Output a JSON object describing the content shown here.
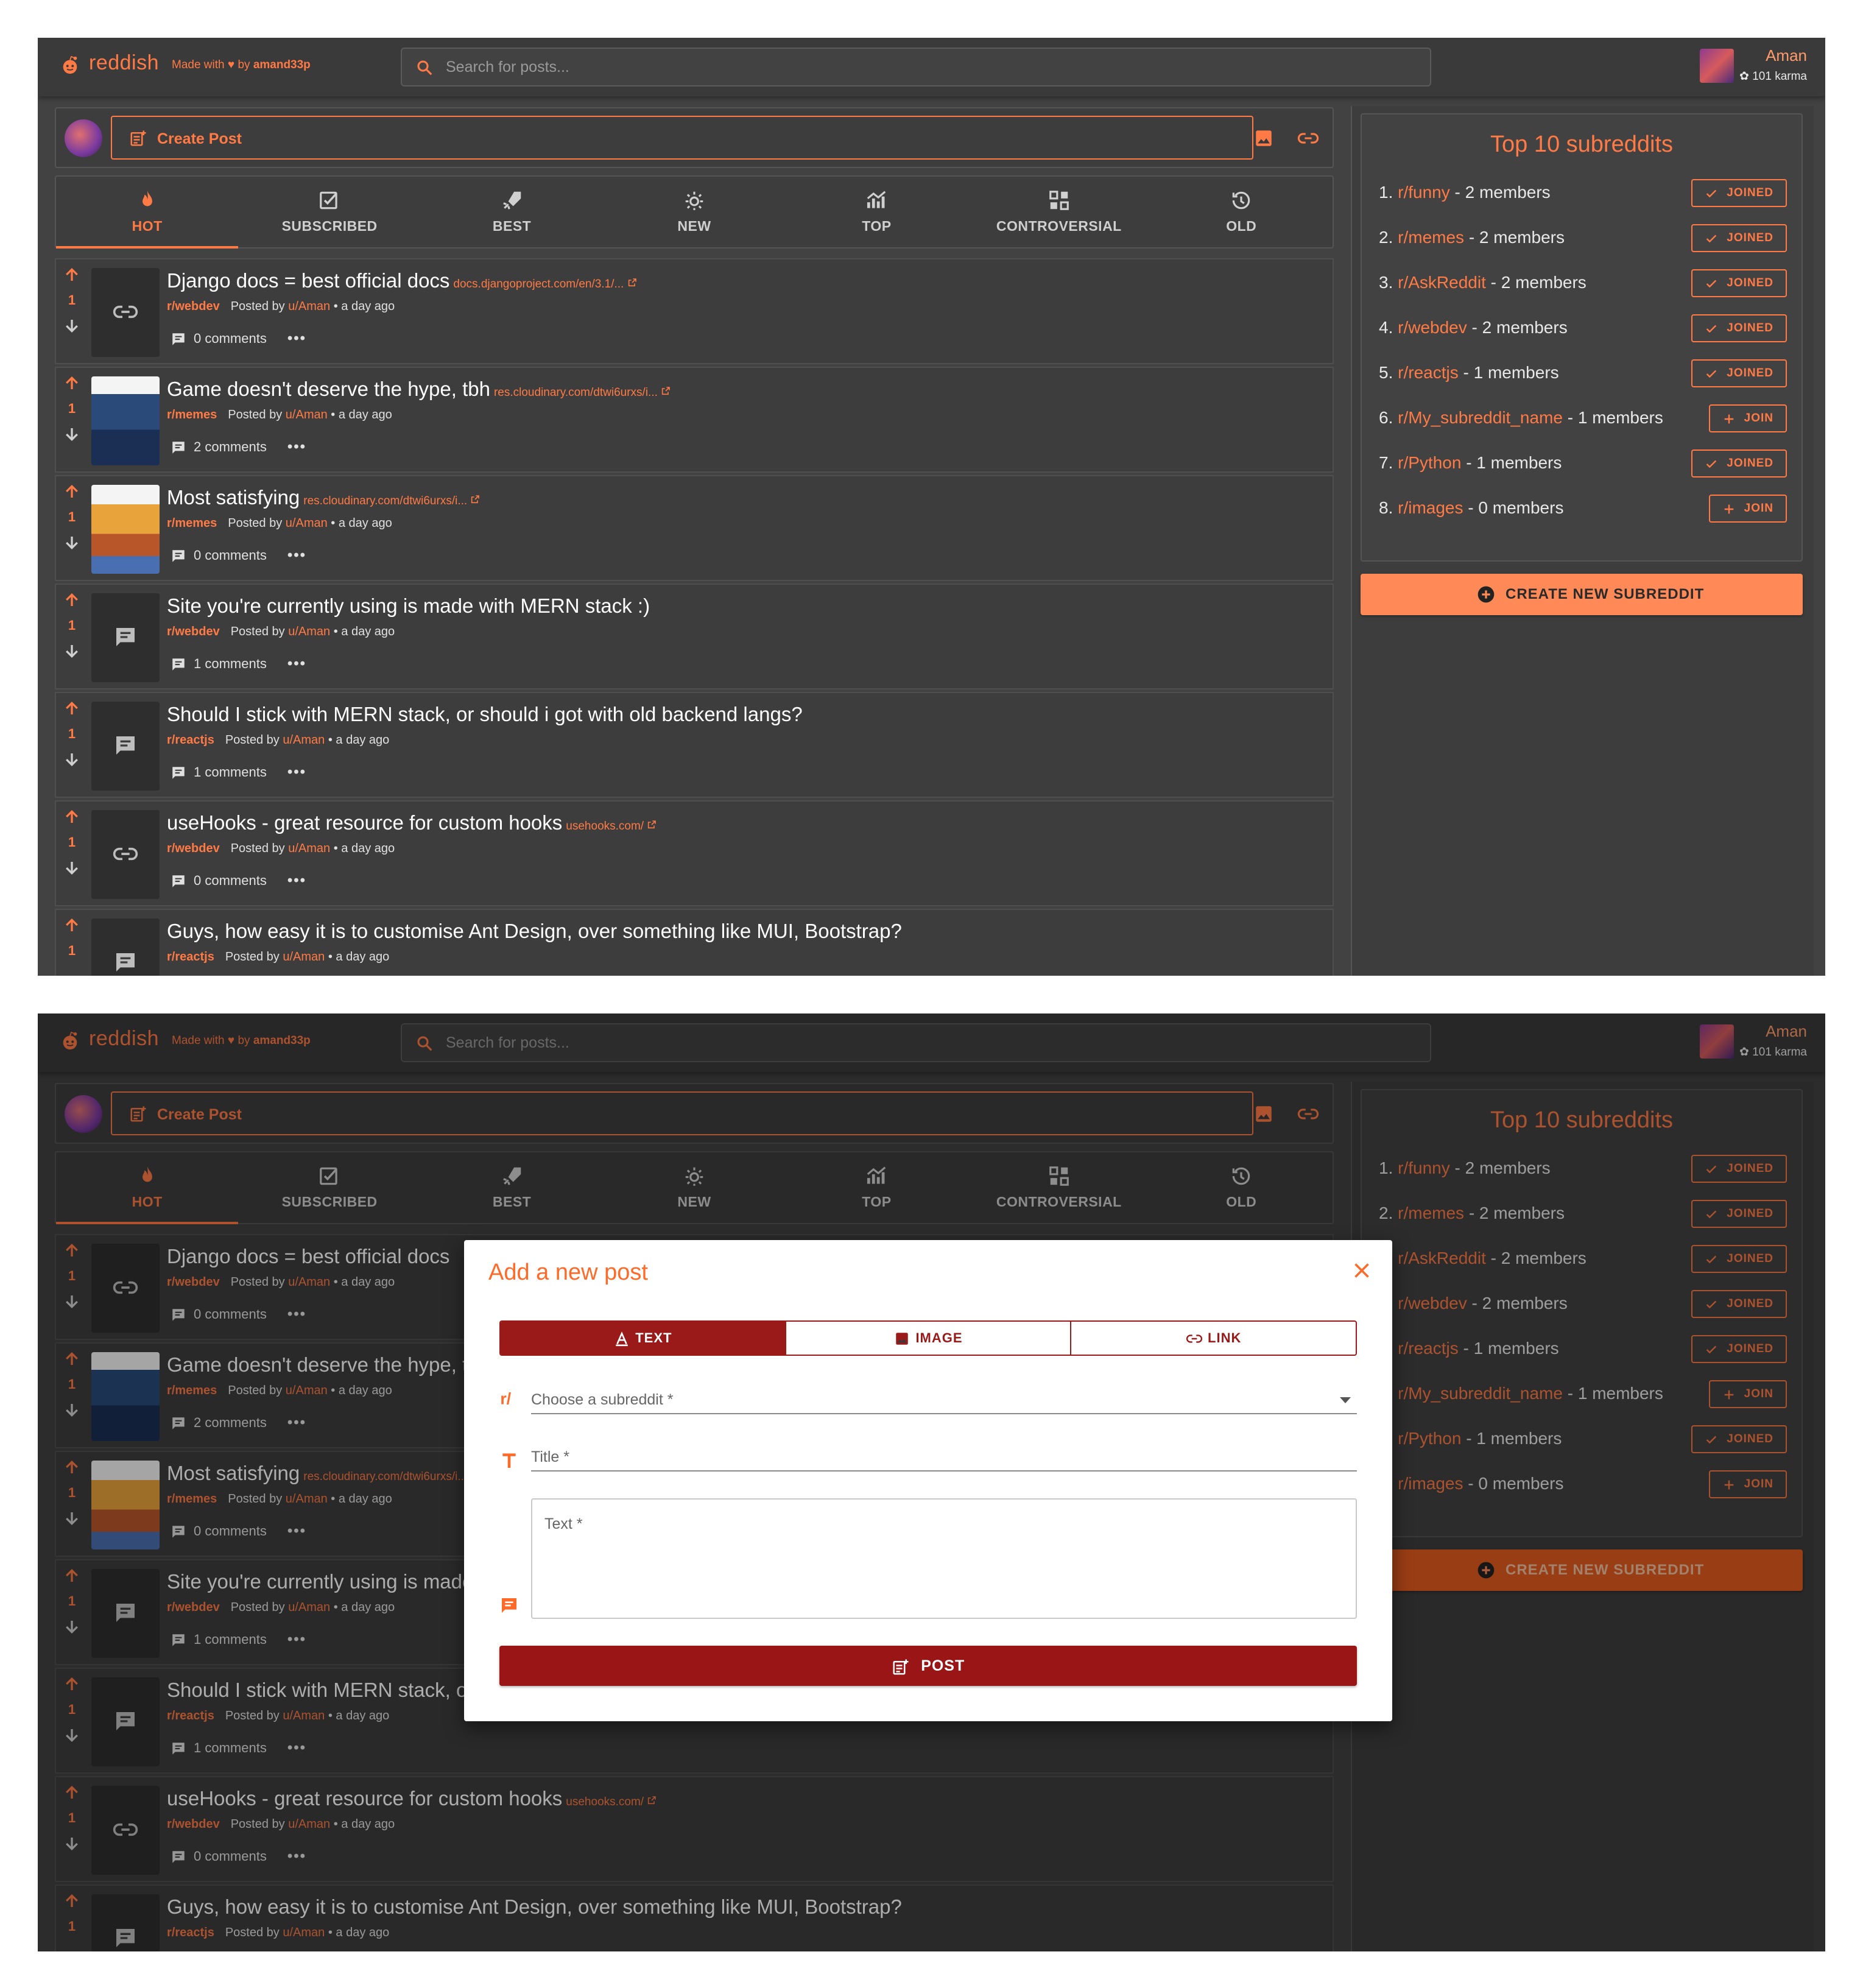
{
  "header": {
    "logo_text": "reddish",
    "made_with_prefix": "Made with",
    "made_with_by": "by",
    "made_with_author": "amand33p",
    "search_placeholder": "Search for posts...",
    "user_name": "Aman",
    "user_karma": "101 karma"
  },
  "create_post": {
    "label": "Create Post"
  },
  "tabs": [
    {
      "label": "HOT",
      "icon": "flame-icon",
      "active": true
    },
    {
      "label": "SUBSCRIBED",
      "icon": "checkbox-icon"
    },
    {
      "label": "BEST",
      "icon": "rocket-icon"
    },
    {
      "label": "NEW",
      "icon": "sun-icon"
    },
    {
      "label": "TOP",
      "icon": "chart-icon"
    },
    {
      "label": "CONTROVERSIAL",
      "icon": "grid-icon"
    },
    {
      "label": "OLD",
      "icon": "history-icon"
    }
  ],
  "posts": [
    {
      "votes": "1",
      "title": "Django docs = best official docs",
      "link": "docs.djangoproject.com/en/3.1/...",
      "subreddit": "r/webdev",
      "posted_by": "Posted by",
      "user": "u/Aman",
      "time": "• a day ago",
      "comments": "0 comments",
      "thumb": "link"
    },
    {
      "votes": "1",
      "title": "Game doesn't deserve the hype, tbh",
      "link": "res.cloudinary.com/dtwi6urxs/i...",
      "subreddit": "r/memes",
      "posted_by": "Posted by",
      "user": "u/Aman",
      "time": "• a day ago",
      "comments": "2 comments",
      "thumb": "image"
    },
    {
      "votes": "1",
      "title": "Most satisfying",
      "link": "res.cloudinary.com/dtwi6urxs/i...",
      "subreddit": "r/memes",
      "posted_by": "Posted by",
      "user": "u/Aman",
      "time": "• a day ago",
      "comments": "0 comments",
      "thumb": "image"
    },
    {
      "votes": "1",
      "title": "Site you're currently using is made with MERN stack :)",
      "link": "",
      "subreddit": "r/webdev",
      "posted_by": "Posted by",
      "user": "u/Aman",
      "time": "• a day ago",
      "comments": "1 comments",
      "thumb": "text"
    },
    {
      "votes": "1",
      "title": "Should I stick with MERN stack, or should i got with old backend langs?",
      "link": "",
      "subreddit": "r/reactjs",
      "posted_by": "Posted by",
      "user": "u/Aman",
      "time": "• a day ago",
      "comments": "1 comments",
      "thumb": "text"
    },
    {
      "votes": "1",
      "title": "useHooks - great resource for custom hooks",
      "link": "usehooks.com/",
      "subreddit": "r/webdev",
      "posted_by": "Posted by",
      "user": "u/Aman",
      "time": "• a day ago",
      "comments": "0 comments",
      "thumb": "link"
    },
    {
      "votes": "1",
      "title": "Guys, how easy it is to customise Ant Design, over something like MUI, Bootstrap?",
      "link": "",
      "subreddit": "r/reactjs",
      "posted_by": "Posted by",
      "user": "u/Aman",
      "time": "• a day ago",
      "comments": "",
      "thumb": "text"
    }
  ],
  "sidebar": {
    "title": "Top 10 subreddits",
    "subreddits": [
      {
        "rank": "1.",
        "name": "r/funny",
        "members": "- 2 members",
        "button": "JOINED"
      },
      {
        "rank": "2.",
        "name": "r/memes",
        "members": "- 2 members",
        "button": "JOINED"
      },
      {
        "rank": "3.",
        "name": "r/AskReddit",
        "members": "- 2 members",
        "button": "JOINED"
      },
      {
        "rank": "4.",
        "name": "r/webdev",
        "members": "- 2 members",
        "button": "JOINED"
      },
      {
        "rank": "5.",
        "name": "r/reactjs",
        "members": "- 1 members",
        "button": "JOINED"
      },
      {
        "rank": "6.",
        "name": "r/My_subreddit_name",
        "members": "- 1 members",
        "button": "JOIN"
      },
      {
        "rank": "7.",
        "name": "r/Python",
        "members": "- 1 members",
        "button": "JOINED"
      },
      {
        "rank": "8.",
        "name": "r/images",
        "members": "- 0 members",
        "button": "JOIN"
      }
    ],
    "create_label": "CREATE NEW SUBREDDIT"
  },
  "dialog": {
    "title": "Add a new post",
    "tabs": [
      {
        "label": "TEXT",
        "active": true
      },
      {
        "label": "IMAGE"
      },
      {
        "label": "LINK"
      }
    ],
    "subreddit_placeholder": "Choose a subreddit *",
    "title_placeholder": "Title *",
    "text_placeholder": "Text *",
    "post_label": "POST"
  },
  "colors": {
    "accent": "#ff7a45",
    "background": "#424242",
    "dialog_primary": "#9a1515"
  }
}
